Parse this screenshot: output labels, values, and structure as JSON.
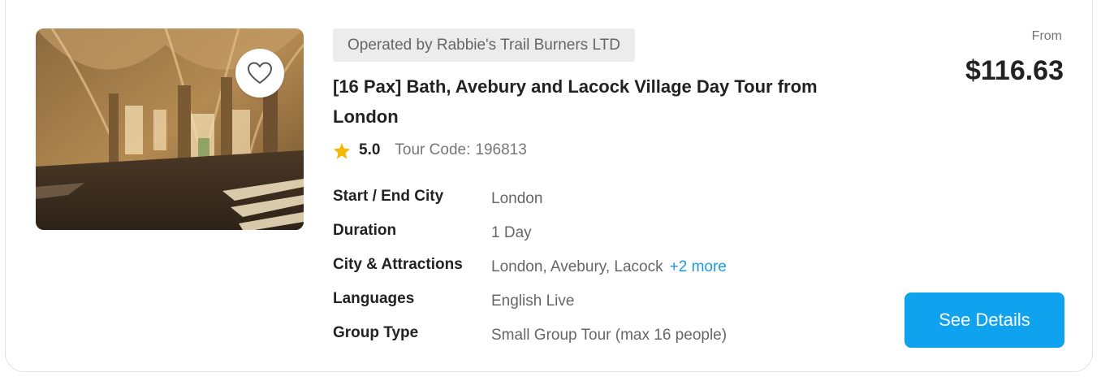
{
  "listing": {
    "operator": "Operated by Rabbie's Trail Burners LTD",
    "title": "[16 Pax] Bath, Avebury and Lacock Village Day Tour from London",
    "rating": "5.0",
    "tour_code_label": "Tour Code:",
    "tour_code": "196813",
    "details": [
      {
        "label": "Start / End City",
        "value": "London"
      },
      {
        "label": "Duration",
        "value": "1 Day"
      },
      {
        "label": "City & Attractions",
        "value": "London, Avebury, Lacock",
        "more": "+2 more"
      },
      {
        "label": "Languages",
        "value": "English Live"
      },
      {
        "label": "Group Type",
        "value": "Small Group Tour (max 16 people)"
      }
    ],
    "price_prefix": "From",
    "price": "$116.63",
    "cta_label": "See Details"
  },
  "icons": {
    "favorite": "heart-outline-icon",
    "rating": "star-icon"
  },
  "colors": {
    "accent": "#0fa2ef",
    "link": "#1a9be0",
    "star": "#f5b800",
    "badge_bg": "#ececec"
  }
}
